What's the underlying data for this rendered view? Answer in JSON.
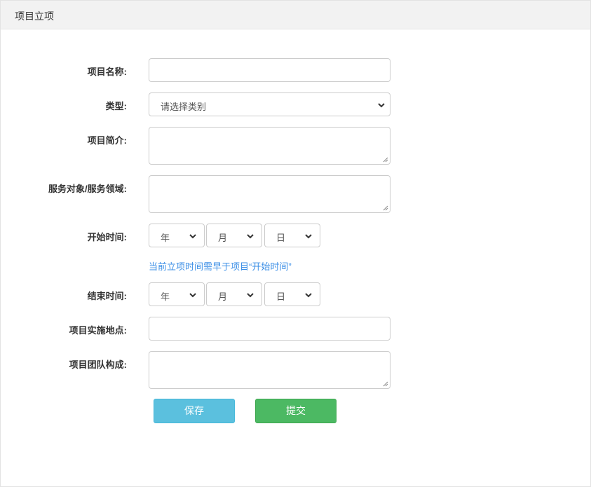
{
  "header": {
    "title": "项目立项"
  },
  "form": {
    "project_name": {
      "label": "项目名称:",
      "value": ""
    },
    "category": {
      "label": "类型:",
      "selected": "请选择类别"
    },
    "intro": {
      "label": "项目简介:",
      "value": ""
    },
    "service": {
      "label": "服务对象/服务领域:",
      "value": ""
    },
    "start_time": {
      "label": "开始时间:",
      "year": "年",
      "month": "月",
      "day": "日"
    },
    "start_hint": "当前立项时间需早于项目“开始时间”",
    "end_time": {
      "label": "结束时间:",
      "year": "年",
      "month": "月",
      "day": "日"
    },
    "location": {
      "label": "项目实施地点:",
      "value": ""
    },
    "team": {
      "label": "项目团队构成:",
      "value": ""
    }
  },
  "actions": {
    "save_label": "保存",
    "submit_label": "提交"
  },
  "colors": {
    "save": "#5bc0de",
    "submit": "#4cb963",
    "hint": "#3a8ee6"
  }
}
